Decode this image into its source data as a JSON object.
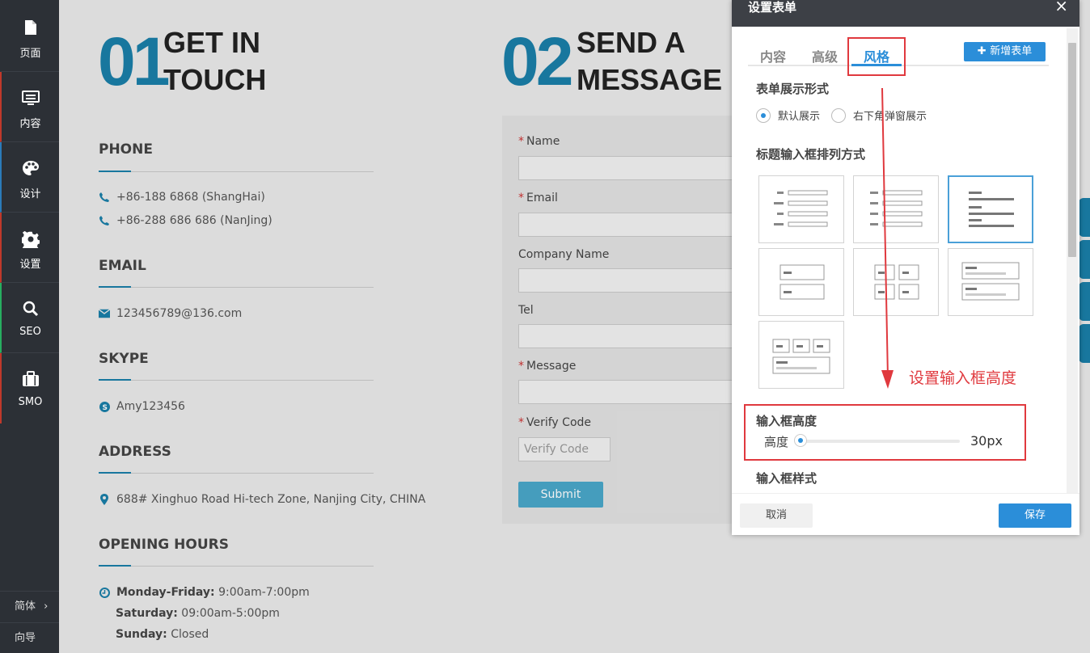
{
  "sidebar": {
    "items": [
      {
        "label": "页面",
        "icon": "page-icon"
      },
      {
        "label": "内容",
        "icon": "content-icon"
      },
      {
        "label": "设计",
        "icon": "palette-icon"
      },
      {
        "label": "设置",
        "icon": "gear-icon"
      },
      {
        "label": "SEO",
        "icon": "search-icon"
      },
      {
        "label": "SMO",
        "icon": "briefcase-icon"
      }
    ],
    "language": "简体",
    "guide": "向导"
  },
  "page": {
    "block1": {
      "num": "01",
      "title_line1": "GET IN",
      "title_line2": "TOUCH"
    },
    "block2": {
      "num": "02",
      "title_line1": "SEND A",
      "title_line2": "MESSAGE"
    },
    "phone": {
      "heading": "PHONE",
      "line1": "+86-188 6868 (ShangHai)",
      "line2": "+86-288 686 686 (NanJing)"
    },
    "email": {
      "heading": "EMAIL",
      "value": "123456789@136.com"
    },
    "skype": {
      "heading": "SKYPE",
      "value": "Amy123456"
    },
    "address": {
      "heading": "ADDRESS",
      "value": "688# Xinghuo Road Hi-tech Zone, Nanjing City, CHINA"
    },
    "hours": {
      "heading": "OPENING HOURS",
      "mf_label": "Monday-Friday:",
      "mf_value": " 9:00am-7:00pm",
      "sat_label": "Saturday:",
      "sat_value": " 09:00am-5:00pm",
      "sun_label": "Sunday:",
      "sun_value": " Closed"
    },
    "form": {
      "name": "Name",
      "email": "Email",
      "company": "Company Name",
      "tel": "Tel",
      "message": "Message",
      "verify": "Verify Code",
      "verify_placeholder": "Verify Code",
      "submit": "Submit"
    }
  },
  "modal": {
    "title": "设置表单",
    "close": "×",
    "tabs": {
      "content": "内容",
      "advanced": "高级",
      "style": "风格"
    },
    "add_form": "新增表单",
    "display_heading": "表单展示形式",
    "radio_default": "默认展示",
    "radio_popup": "右下角弹窗展示",
    "layout_heading": "标题输入框排列方式",
    "annotation": "设置输入框高度",
    "height_heading": "输入框高度",
    "height_label": "高度",
    "height_value": "30px",
    "input_style_heading": "输入框样式",
    "cancel": "取消",
    "save": "保存"
  },
  "colors": {
    "accent": "#2b8ed9",
    "brand": "#1a7fa8",
    "annotation": "#e0393e",
    "sidebar": "#2c3036"
  }
}
